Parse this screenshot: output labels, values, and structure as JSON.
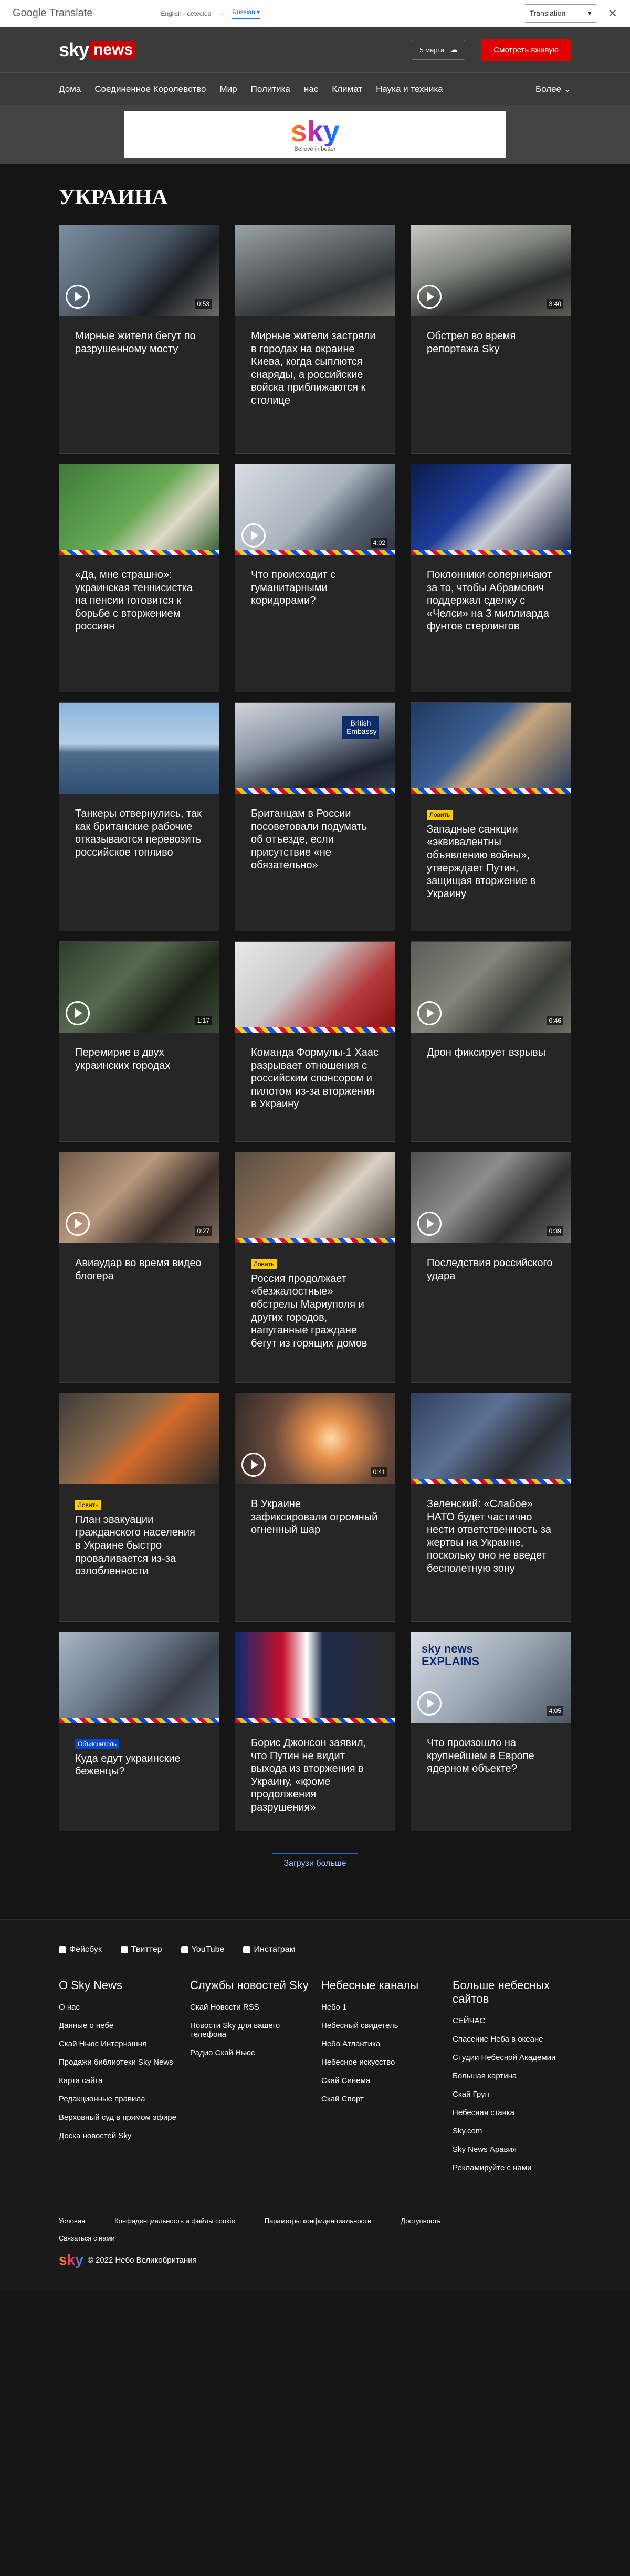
{
  "translate": {
    "logo": "Google Translate",
    "detected": "English - detected",
    "target": "Russian",
    "select": "Translation"
  },
  "header": {
    "logo_sky": "sky",
    "logo_news": "news",
    "date": "5 марта",
    "watch_live": "Смотреть вживую",
    "nav": [
      "Дома",
      "Соединенное Королевство",
      "Мир",
      "Политика",
      "нас",
      "Климат",
      "Наука и техника"
    ],
    "more": "Более"
  },
  "ad": {
    "brand": "sky",
    "tagline": "Believe in better"
  },
  "section": {
    "title": "УКРАИНА"
  },
  "cards": [
    {
      "title": "Мирные жители бегут по разрушенному мосту",
      "duration": "0:53"
    },
    {
      "title": "Мирные жители застряли в городах на окраине Киева, когда сыплются снаряды, а российские войска приближаются к столице",
      "duration": ""
    },
    {
      "title": "Обстрел во время репортажа Sky",
      "duration": "3:40"
    },
    {
      "title": "«Да, мне страшно»: украинская теннисистка на пенсии готовится к борьбе с вторжением россиян",
      "duration": ""
    },
    {
      "title": "Что происходит с гуманитарными коридорами?",
      "duration": "4:02"
    },
    {
      "title": "Поклонники соперничают за то, чтобы Абрамович поддержал сделку с «Челси» на 3 миллиарда фунтов стерлингов",
      "duration": ""
    },
    {
      "title": "Танкеры отвернулись, так как британские рабочие отказываются перевозить российское топливо",
      "duration": ""
    },
    {
      "title": "Британцам в России посоветовали подумать об отъезде, если присутствие «не обязательно»",
      "duration": "",
      "thumb_text": "British Embassy"
    },
    {
      "title": "Западные санкции «эквивалентны объявлению войны», утверждает Путин, защищая вторжение в Украину",
      "duration": "",
      "badge": "Ловить"
    },
    {
      "title": "Перемирие в двух украинских городах",
      "duration": "1:17"
    },
    {
      "title": "Команда Формулы-1 Хаас разрывает отношения с российским спонсором и пилотом из-за вторжения в Украину",
      "duration": ""
    },
    {
      "title": "Дрон фиксирует взрывы",
      "duration": "0:46"
    },
    {
      "title": "Авиаудар во время видео блогера",
      "duration": "0:27"
    },
    {
      "title": "Россия продолжает «безжалостные» обстрелы Мариуполя и других городов, напуганные граждане бегут из горящих домов",
      "duration": "",
      "badge": "Ловить"
    },
    {
      "title": "Последствия российского удара",
      "duration": "0:39"
    },
    {
      "title": "План эвакуации гражданского населения в Украине быстро проваливается из-за озлобленности",
      "duration": "",
      "badge": "Ловить"
    },
    {
      "title": "В Украине зафиксировали огромный огненный шар",
      "duration": "0:41"
    },
    {
      "title": "Зеленский: «Слабое» НАТО будет частично нести ответственность за жертвы на Украине, поскольку оно не введет бесполетную зону",
      "duration": ""
    },
    {
      "title": "Куда едут украинские беженцы?",
      "duration": "",
      "badge": "Объяснитель"
    },
    {
      "title": "Борис Джонсон заявил, что Путин не видит выхода из вторжения в Украину, «кроме продолжения разрушения»",
      "duration": ""
    },
    {
      "title": "Что произошло на крупнейшем в Европе ядерном объекте?",
      "duration": "4:05",
      "thumb_text": "sky news EXPLAINS"
    }
  ],
  "load_more": "Загрузи больше",
  "footer": {
    "social": [
      "Фейсбук",
      "Твиттер",
      "YouTube",
      "Инстаграм"
    ],
    "col1": {
      "title": "О Sky News",
      "links": [
        "О нас",
        "Данные о небе",
        "Скай Ньюс Интернэшнл",
        "Продажи библиотеки Sky News",
        "Карта сайта",
        "Редакционные правила",
        "Верховный суд в прямом эфире",
        "Доска новостей Sky"
      ]
    },
    "col2": {
      "title": "Службы новостей Sky",
      "links": [
        "Скай Новости RSS",
        "Новости Sky для вашего телефона",
        "Радио Скай Ньюс"
      ]
    },
    "col3": {
      "title": "Небесные каналы",
      "links": [
        "Небо 1",
        "Небесный свидетель",
        "Небо Атлантика",
        "Небесное искусство",
        "Скай Синема",
        "Скай Спорт"
      ]
    },
    "col4": {
      "title": "Больше небесных сайтов",
      "links": [
        "СЕЙЧАС",
        "Спасение Неба в океане",
        "Студии Небесной Академии",
        "Большая картина",
        "Скай Груп",
        "Небесная ставка",
        "Sky.com",
        "Sky News Аравия",
        "Рекламируйте с нами"
      ]
    },
    "legal": [
      "Условия",
      "Конфиденциальность и файлы cookie",
      "Параметры конфиденциальности",
      "Доступность"
    ],
    "contact": "Связаться с нами",
    "copyright": "© 2022 Небо Великобритания"
  },
  "colors": {
    "accent_red": "#e10000",
    "badge_yellow": "#ffcc00",
    "link_blue": "#1e6bd9"
  }
}
